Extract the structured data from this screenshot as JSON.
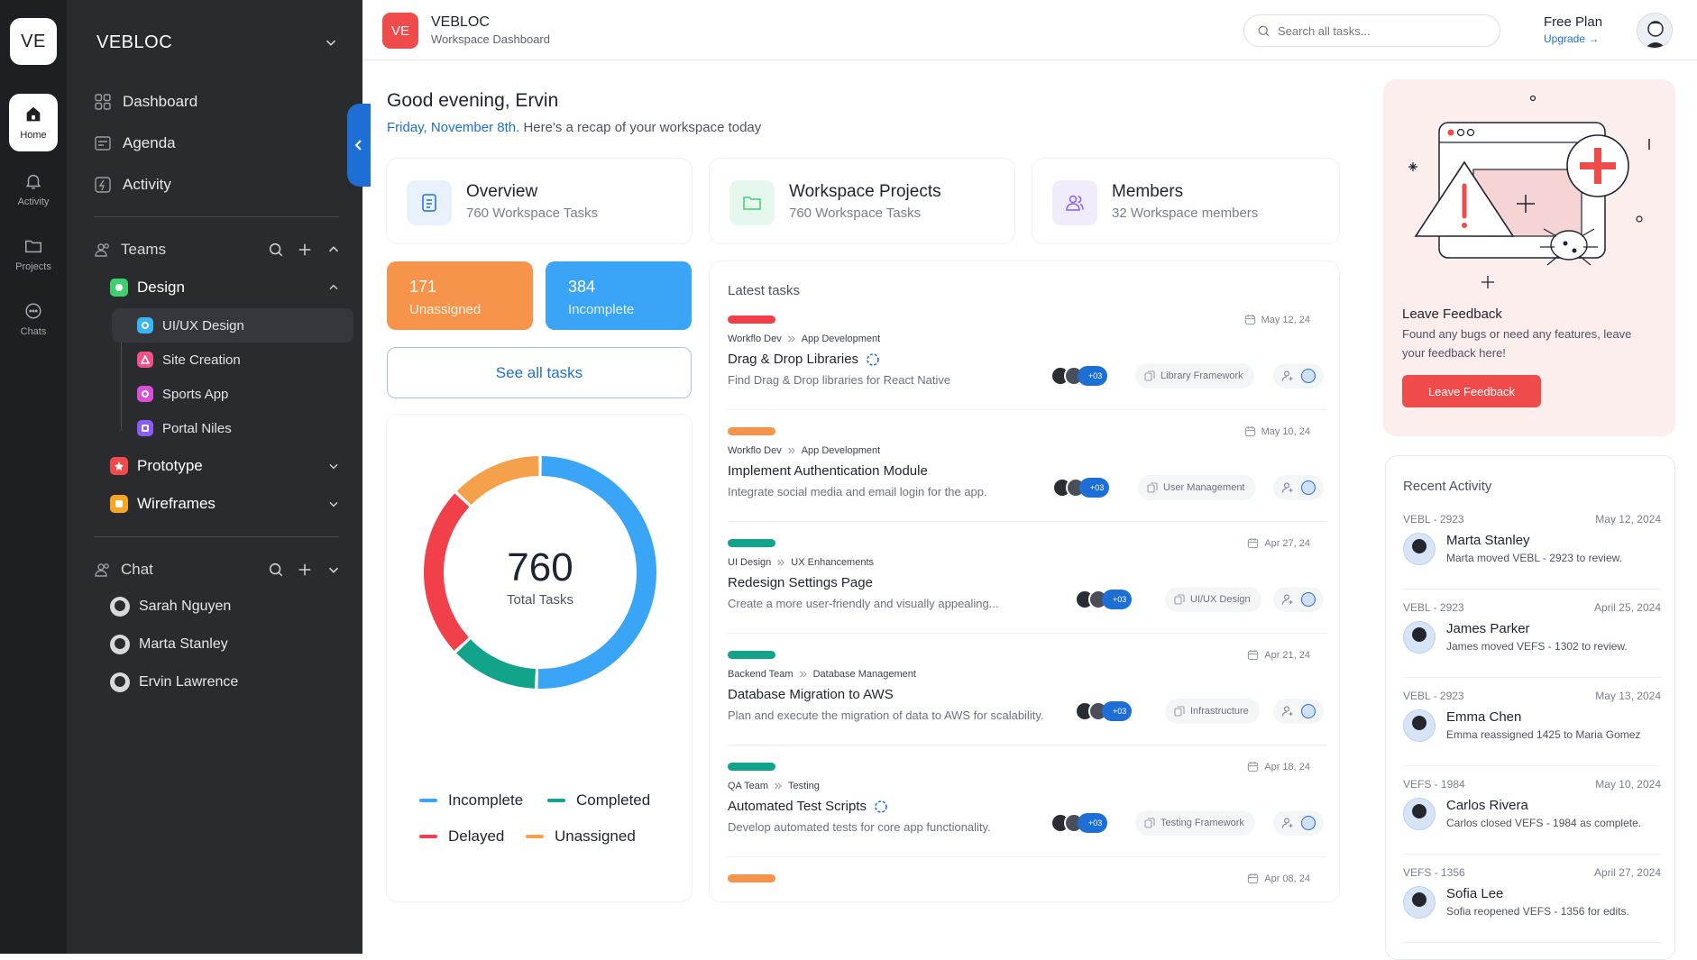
{
  "rail": {
    "logo": "VE",
    "items": [
      {
        "label": "Home",
        "icon": "home-icon"
      },
      {
        "label": "Activity",
        "icon": "bell-icon"
      },
      {
        "label": "Projects",
        "icon": "folder-icon"
      },
      {
        "label": "Chats",
        "icon": "chat-icon"
      }
    ]
  },
  "sidebar": {
    "workspace": "VEBLOC",
    "nav": [
      {
        "label": "Dashboard",
        "icon": "grid-icon"
      },
      {
        "label": "Agenda",
        "icon": "agenda-icon"
      },
      {
        "label": "Activity",
        "icon": "activity-icon"
      }
    ],
    "teams": {
      "label": "Teams",
      "groups": [
        {
          "label": "Design",
          "color": "#3ecf6e",
          "expanded": true,
          "items": [
            {
              "label": "UI/UX Design",
              "color": "#38b6f5"
            },
            {
              "label": "Site Creation",
              "color": "#f25287"
            },
            {
              "label": "Sports App",
              "color": "#d94fd6"
            },
            {
              "label": "Portal Niles",
              "color": "#8b5cf6"
            }
          ]
        },
        {
          "label": "Prototype",
          "color": "#ef4b4b"
        },
        {
          "label": "Wireframes",
          "color": "#f5a623"
        }
      ]
    },
    "chat": {
      "label": "Chat",
      "users": [
        "Sarah Nguyen",
        "Marta Stanley",
        "Ervin Lawrence"
      ]
    }
  },
  "header": {
    "logo": "VE",
    "title": "VEBLOC",
    "subtitle": "Workspace Dashboard",
    "search_placeholder": "Search all tasks...",
    "plan": "Free Plan",
    "upgrade": "Upgrade →"
  },
  "greeting": {
    "title": "Good evening, Ervin",
    "date": "Friday, November 8th.",
    "text": " Here's a recap of your workspace today"
  },
  "stats": [
    {
      "title": "Overview",
      "sub": "760 Workspace Tasks",
      "icon": "document-icon",
      "bg": "#e8f1fc",
      "color": "#1d6fd6"
    },
    {
      "title": "Workspace Projects",
      "sub": "760 Workspace Tasks",
      "icon": "folder-icon",
      "bg": "#e6f7ee",
      "color": "#3ecf6e"
    },
    {
      "title": "Members",
      "sub": "32 Workspace members",
      "icon": "users-icon",
      "bg": "#f1ecfb",
      "color": "#8b5cf6"
    }
  ],
  "tiles": [
    {
      "value": "171",
      "label": "Unassigned",
      "color": "#f5944a"
    },
    {
      "value": "384",
      "label": "Incomplete",
      "color": "#3aa4f7"
    }
  ],
  "see_all": "See all tasks",
  "chart_data": {
    "type": "pie",
    "center_value": "760",
    "center_label": "Total Tasks",
    "slices": [
      {
        "name": "Incomplete",
        "value": 384,
        "color": "#3aa4f7"
      },
      {
        "name": "Completed",
        "value": 95,
        "color": "#12a38b"
      },
      {
        "name": "Delayed",
        "value": 183,
        "color": "#f2404a"
      },
      {
        "name": "Unassigned",
        "value": 98,
        "color": "#f5a04a"
      }
    ],
    "legend": [
      "Incomplete",
      "Completed",
      "Delayed",
      "Unassigned"
    ],
    "legend_placement": "bottom"
  },
  "tasks": {
    "heading": "Latest tasks",
    "items": [
      {
        "bar": "#f2404a",
        "date": "May 12, 24",
        "team": "Workflo Dev",
        "project": "App Development",
        "title": "Drag & Drop Libraries",
        "loading": true,
        "desc": "Find Drag & Drop libraries for React Native",
        "more": "+03",
        "tag": "Library Framework"
      },
      {
        "bar": "#f5944a",
        "date": "May 10, 24",
        "team": "Workflo Dev",
        "project": "App Development",
        "title": "Implement Authentication Module",
        "loading": false,
        "desc": "Integrate social media and email login for the app.",
        "more": "+03",
        "tag": "User Management"
      },
      {
        "bar": "#12a38b",
        "date": "Apr 27, 24",
        "team": "UI Design",
        "project": "UX Enhancements",
        "title": "Redesign Settings Page",
        "loading": false,
        "desc": "Create a more user-friendly and visually appealing...",
        "more": "+03",
        "tag": "UI/UX Design"
      },
      {
        "bar": "#12a38b",
        "date": "Apr 21, 24",
        "team": "Backend Team",
        "project": "Database Management",
        "title": "Database Migration to AWS",
        "loading": false,
        "desc": "Plan and execute the migration of data to AWS for scalability.",
        "more": "+03",
        "tag": "Infrastructure"
      },
      {
        "bar": "#12a38b",
        "date": "Apr 18, 24",
        "team": "QA Team",
        "project": "Testing",
        "title": "Automated Test Scripts",
        "loading": true,
        "desc": "Develop automated tests for core app functionality.",
        "more": "+03",
        "tag": "Testing Framework"
      },
      {
        "bar": "#f5944a",
        "date": "Apr 08, 24",
        "team": "",
        "project": "",
        "title": "",
        "loading": false,
        "desc": "",
        "more": "",
        "tag": ""
      }
    ]
  },
  "feedback": {
    "title": "Leave Feedback",
    "text": "Found any bugs or need any features, leave your feedback here!",
    "button": "Leave Feedback"
  },
  "activity": {
    "heading": "Recent Activity",
    "items": [
      {
        "code": "VEBL - 2923",
        "date": "May 12, 2024",
        "name": "Marta Stanley",
        "msg": "Marta moved VEBL - 2923 to review."
      },
      {
        "code": "VEBL - 2923",
        "date": "April 25, 2024",
        "name": "James Parker",
        "msg": "James moved VEFS - 1302 to review."
      },
      {
        "code": "VEBL - 2923",
        "date": "May 13, 2024",
        "name": "Emma Chen",
        "msg": "Emma reassigned 1425 to Maria Gomez"
      },
      {
        "code": "VEFS - 1984",
        "date": "May 10, 2024",
        "name": "Carlos Rivera",
        "msg": "Carlos closed VEFS - 1984 as complete."
      },
      {
        "code": "VEFS - 1356",
        "date": "April 27, 2024",
        "name": "Sofia Lee",
        "msg": "Sofia reopened VEFS - 1356 for edits."
      }
    ]
  }
}
